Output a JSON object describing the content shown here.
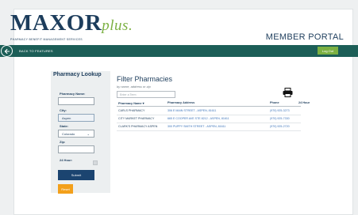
{
  "brand": {
    "logo_main": "MAXOR",
    "logo_plus": "plus.",
    "tagline": "PHARMACY BENEFIT MANAGEMENT SERVICES",
    "portal_title": "MEMBER PORTAL"
  },
  "navbar": {
    "back_label": "BACK TO FEATURES",
    "logout_label": "Log Out",
    "accent": "#1c5e57"
  },
  "sidebar": {
    "title": "Pharmacy Lookup",
    "name_label": "Pharmacy Name:",
    "name_value": "",
    "city_label": "City:",
    "city_value": "Aspen",
    "state_label": "State:",
    "state_value": "Colorado",
    "zip_label": "Zip:",
    "zip_value": "",
    "hour24_label": "24 Hour:",
    "submit_label": "Submit",
    "reset_label": "Reset"
  },
  "main": {
    "title": "Filter Pharmacies",
    "subtitle": "by name, address or zip",
    "search_placeholder": "Enter a Term",
    "columns": [
      "Pharmacy Name ▾",
      "Pharmacy Address",
      "Phone",
      "24 Hour"
    ],
    "rows": [
      {
        "name": "CARLS PHARMACY",
        "address": "306 E MAIN STREET - ASPEN, 81611",
        "phone": "(970) 925-3273"
      },
      {
        "name": "CITY MARKET PHARMACY",
        "address": "665 E COOPER AVE STE 8212 - ASPEN, 81611",
        "phone": "(970) 925-7330"
      },
      {
        "name": "CLARK'S PHARMACY ASPEN",
        "address": "300 PUPPY SMITH STREET - ASPEN, 81611",
        "phone": "(970) 925-2720"
      }
    ]
  },
  "colors": {
    "navy": "#1d3d5c",
    "green": "#7bb042",
    "submit": "#1b4470",
    "reset": "#f3a01b"
  }
}
